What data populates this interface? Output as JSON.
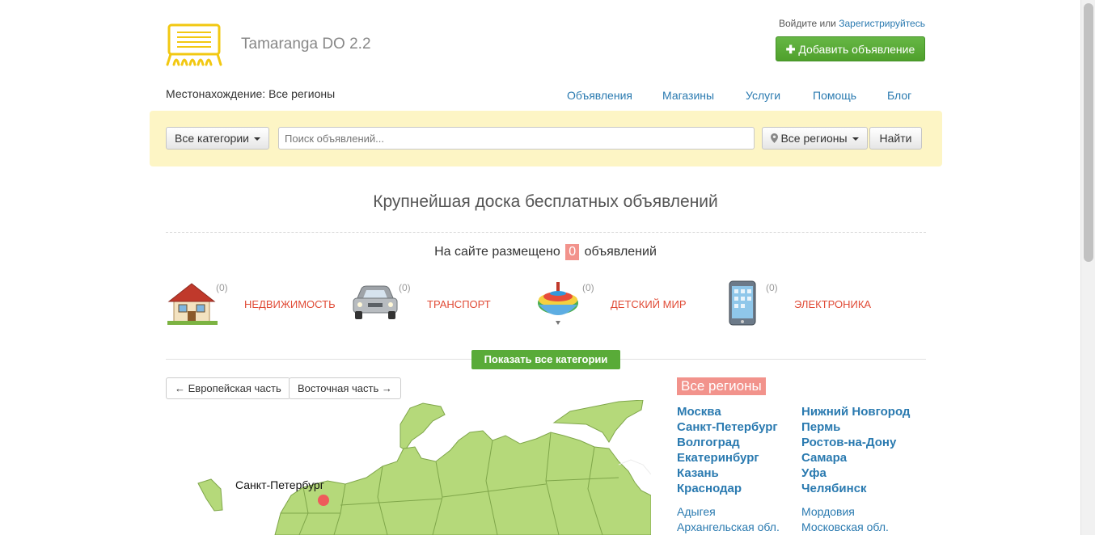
{
  "header": {
    "site_name": "Tamaranga DO 2.2",
    "login_label": "Войдите",
    "or_label": "или",
    "register_label": "Зарегистрируйтесь",
    "add_button": "Добавить объявление"
  },
  "location": {
    "text": "Местонахождение: Все регионы"
  },
  "nav": [
    "Объявления",
    "Магазины",
    "Услуги",
    "Помощь",
    "Блог"
  ],
  "search": {
    "categories_label": "Все категории",
    "placeholder": "Поиск объявлений...",
    "region_label": "Все регионы",
    "submit_label": "Найти"
  },
  "hero": {
    "title": "Крупнейшая доска бесплатных объявлений",
    "stats_before": "На сайте размещено",
    "stats_count": "0",
    "stats_after": "объявлений"
  },
  "categories": [
    {
      "name": "НЕДВИЖИМОСТЬ",
      "count": "(0)",
      "icon": "house-icon"
    },
    {
      "name": "ТРАНСПОРТ",
      "count": "(0)",
      "icon": "car-icon"
    },
    {
      "name": "ДЕТСКИЙ МИР",
      "count": "(0)",
      "icon": "spinning-top-icon"
    },
    {
      "name": "ЭЛЕКТРОНИКА",
      "count": "(0)",
      "icon": "phone-icon"
    }
  ],
  "show_all_label": "Показать все категории",
  "map": {
    "west_button": "← Европейская часть",
    "east_button": "Восточная часть →",
    "city_label": "Санкт-Петербург"
  },
  "regions": {
    "title": "Все регионы",
    "major_left": [
      "Москва",
      "Санкт-Петербург",
      "Волгоград",
      "Екатеринбург",
      "Казань",
      "Краснодар"
    ],
    "major_right": [
      "Нижний Новгород",
      "Пермь",
      "Ростов-на-Дону",
      "Самара",
      "Уфа",
      "Челябинск"
    ],
    "minor_left": [
      "Адыгея",
      "Архангельская обл."
    ],
    "minor_right": [
      "Мордовия",
      "Московская обл."
    ]
  },
  "colors": {
    "accent_green": "#59ab38",
    "link_blue": "#2a7ab0",
    "category_red": "#e04a35",
    "badge_pink": "#f2938c",
    "search_bg": "#fdf5c5",
    "map_green": "#b5d97a"
  }
}
